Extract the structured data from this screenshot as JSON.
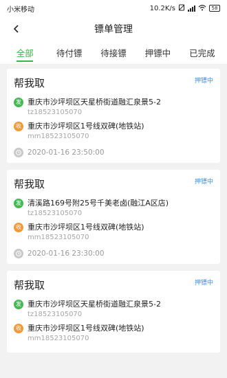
{
  "status_bar": {
    "carrier": "小米移动",
    "speed": "10.2K/s",
    "battery": "58"
  },
  "nav": {
    "title": "镖单管理"
  },
  "tabs": [
    {
      "label": "全部",
      "active": true
    },
    {
      "label": "待付镖",
      "active": false
    },
    {
      "label": "待接镖",
      "active": false
    },
    {
      "label": "押镖中",
      "active": false
    },
    {
      "label": "已完成",
      "active": false
    }
  ],
  "labels": {
    "send": "发",
    "receive": "收"
  },
  "orders": [
    {
      "title": "帮我取",
      "status": "押镖中",
      "from_address": "重庆市沙坪坝区天星桥街道融汇泉景5-2",
      "from_contact": "tz18523105070",
      "to_address": "重庆市沙坪坝区1号线双碑(地铁站)",
      "to_contact": "mm18523105070",
      "time": "2020-01-16 23:50:00"
    },
    {
      "title": "帮我取",
      "status": "押镖中",
      "from_address": "清溪路169号附25号千美老卤(融江A区店)",
      "from_contact": "tz18523105070",
      "to_address": "重庆市沙坪坝区1号线双碑(地铁站)",
      "to_contact": "mm18523105070",
      "time": "2020-01-16 23:30:00"
    },
    {
      "title": "帮我取",
      "status": "押镖中",
      "from_address": "重庆市沙坪坝区天星桥街道融汇泉景5-2",
      "from_contact": "tz18523105070",
      "to_address": "重庆市沙坪坝区1号线双碑(地铁站)",
      "to_contact": "mm18523105070",
      "time": ""
    }
  ]
}
